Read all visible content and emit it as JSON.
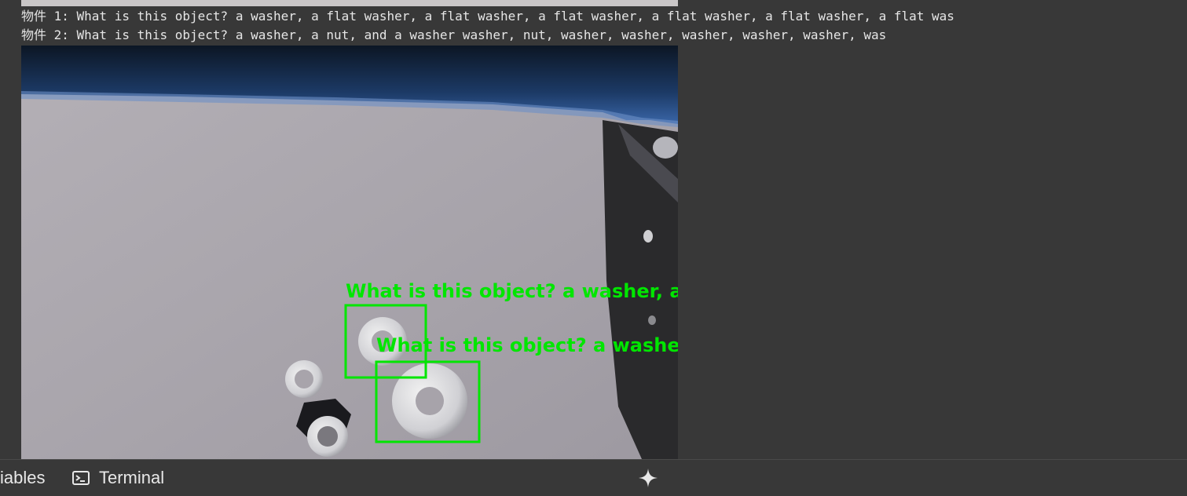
{
  "output": {
    "lines": [
      "物件 1: What is this object? a washer, a flat washer, a flat washer, a flat washer, a flat washer, a flat washer, a flat was",
      "物件 2: What is this object? a washer, a nut, and a washer washer, nut, washer, washer, washer, washer, washer, was"
    ]
  },
  "image": {
    "detections": [
      {
        "label": "What is this object? a washer, a "
      },
      {
        "label": "What is this object? a washer,"
      }
    ],
    "box_color": "#00e600"
  },
  "bottom_bar": {
    "variables_label": "iables",
    "terminal_label": "Terminal",
    "terminal_icon": "terminal-icon",
    "sparkle_icon": "sparkle-icon"
  }
}
